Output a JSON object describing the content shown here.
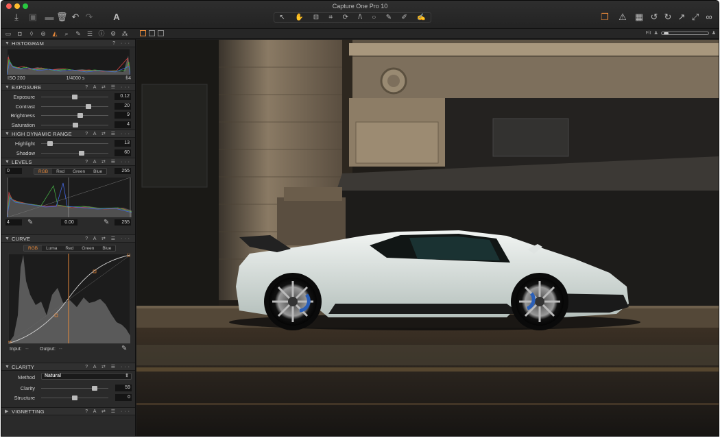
{
  "app": {
    "title": "Capture One Pro 10"
  },
  "colors": {
    "accent": "#e8893a",
    "panel": "#2a2a2a",
    "background": "#1e1e1e"
  },
  "toolbar": {
    "left_icons": [
      "import-icon",
      "camera-icon",
      "folder-icon",
      "trash-icon",
      "undo-icon",
      "redo-icon",
      "text-icon"
    ],
    "tools": [
      "select-icon",
      "pan-icon",
      "loupe-icon",
      "crop-icon",
      "rotate-icon",
      "keystone-icon",
      "spot-icon",
      "brush-icon",
      "picker-icon",
      "cursor-icon"
    ],
    "right_icons": [
      "stack-icon",
      "warning-icon",
      "grid-icon",
      "rotate-left-icon",
      "rotate-right-icon",
      "cursor-arrow-icon",
      "glasses-icon"
    ]
  },
  "viewerbar": {
    "fit_label": "Fit"
  },
  "histogram": {
    "title": "HISTOGRAM",
    "iso": "ISO 200",
    "shutter": "1/4000 s",
    "aperture": "f/4"
  },
  "exposure": {
    "title": "EXPOSURE",
    "sliders": [
      {
        "label": "Exposure",
        "value": "0.12",
        "pos": 0.5
      },
      {
        "label": "Contrast",
        "value": "20",
        "pos": 0.7
      },
      {
        "label": "Brightness",
        "value": "9",
        "pos": 0.58
      },
      {
        "label": "Saturation",
        "value": "4",
        "pos": 0.51
      }
    ]
  },
  "hdr": {
    "title": "HIGH DYNAMIC RANGE",
    "sliders": [
      {
        "label": "Highlight",
        "value": "13",
        "pos": 0.13
      },
      {
        "label": "Shadow",
        "value": "60",
        "pos": 0.6
      }
    ]
  },
  "levels": {
    "title": "LEVELS",
    "left_value": "0",
    "right_value": "255",
    "channels": [
      "RGB",
      "Red",
      "Green",
      "Blue"
    ],
    "active_channel": "RGB",
    "low": "4",
    "mid": "0.00",
    "high": "255"
  },
  "curve": {
    "title": "CURVE",
    "channels": [
      "RGB",
      "Luma",
      "Red",
      "Green",
      "Blue"
    ],
    "active_channel": "RGB",
    "input_label": "Input:",
    "input_value": "--",
    "output_label": "Output:",
    "output_value": "--"
  },
  "clarity": {
    "title": "CLARITY",
    "method_label": "Method",
    "method_value": "Natural",
    "sliders": [
      {
        "label": "Clarity",
        "value": "59",
        "pos": 0.8
      },
      {
        "label": "Structure",
        "value": "0",
        "pos": 0.5
      }
    ]
  },
  "vignetting": {
    "title": "VIGNETTING"
  }
}
